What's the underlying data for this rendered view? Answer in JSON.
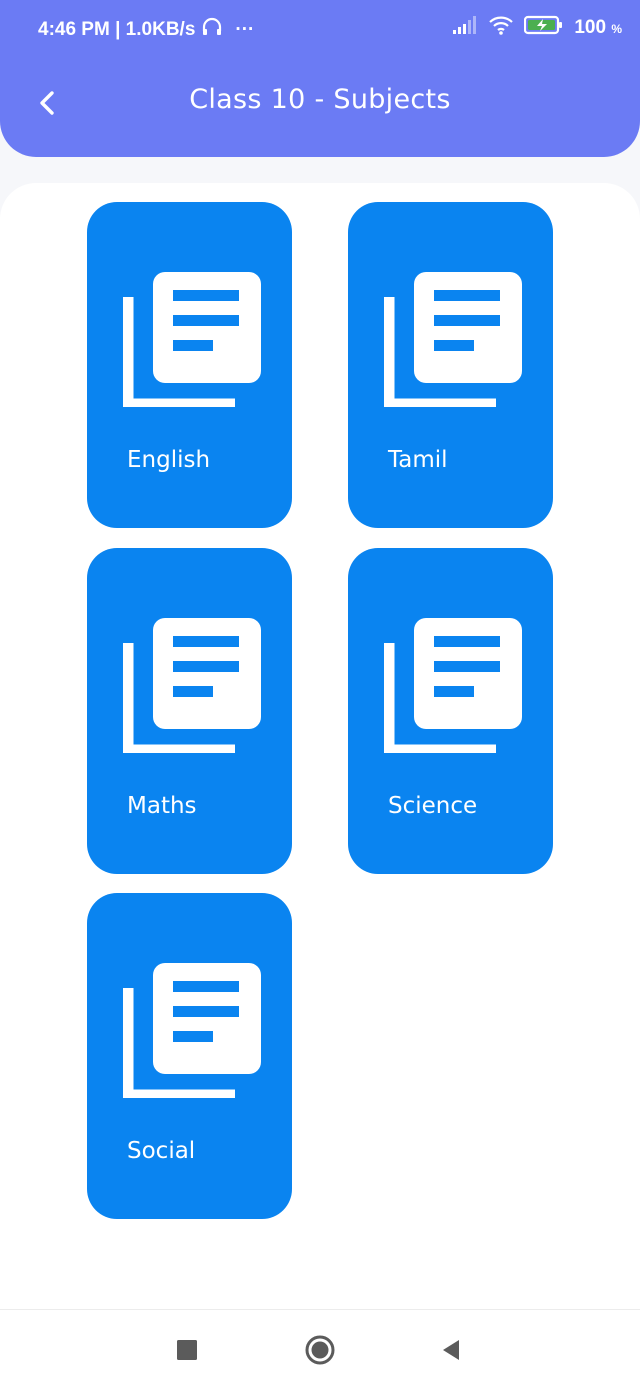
{
  "status_bar": {
    "time_speed": "4:46 PM | 1.0KB/s",
    "more": "···",
    "battery": "100",
    "battery_unit": "%"
  },
  "header": {
    "title": "Class 10 - Subjects",
    "back_icon": "chevron-left-icon"
  },
  "subjects": [
    {
      "label": "English",
      "icon": "library-books-icon"
    },
    {
      "label": "Tamil",
      "icon": "library-books-icon"
    },
    {
      "label": "Maths",
      "icon": "library-books-icon"
    },
    {
      "label": "Science",
      "icon": "library-books-icon"
    },
    {
      "label": "Social",
      "icon": "library-books-icon"
    }
  ],
  "nav_bar": {
    "recents_icon": "square-icon",
    "home_icon": "circle-icon",
    "back_icon": "triangle-back-icon"
  },
  "colors": {
    "header": "#6b7bf4",
    "tile": "#0a84f0"
  }
}
